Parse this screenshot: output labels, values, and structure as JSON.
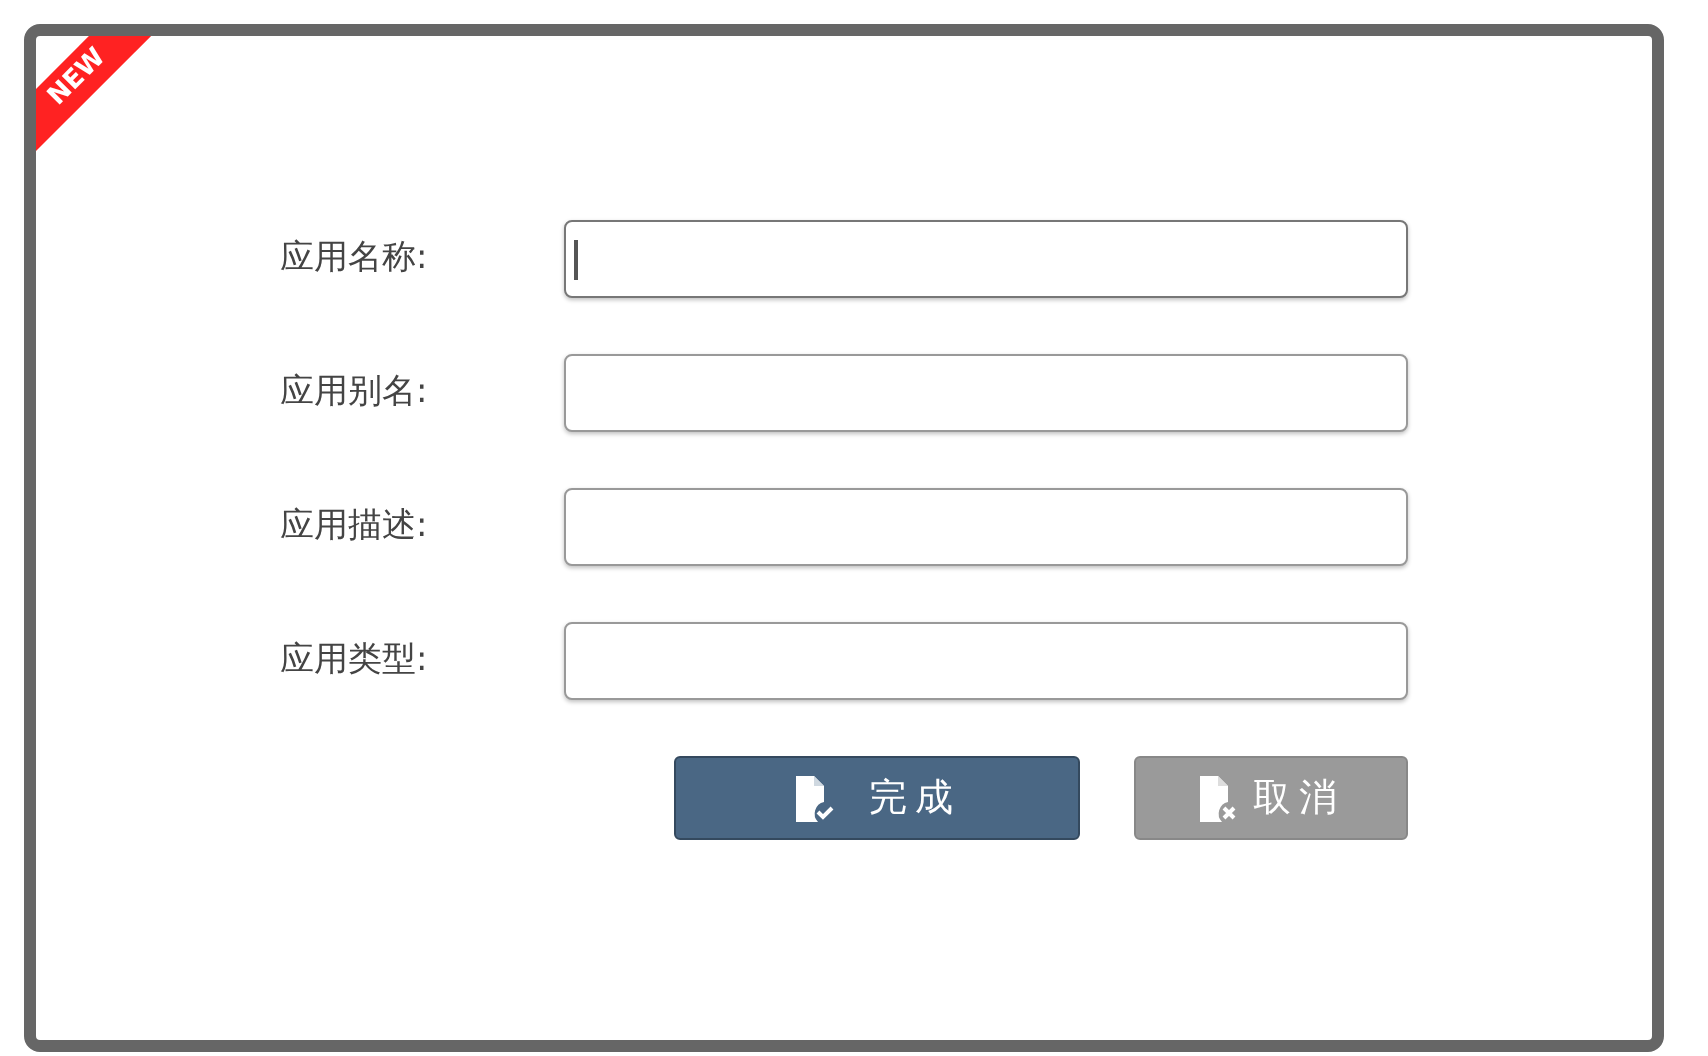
{
  "ribbon": {
    "label": "NEW"
  },
  "fields": [
    {
      "label": "应用名称:",
      "focused": true
    },
    {
      "label": "应用别名:",
      "focused": false
    },
    {
      "label": "应用描述:",
      "focused": false
    },
    {
      "label": "应用类型:",
      "focused": false
    }
  ],
  "buttons": [
    {
      "label": "完成",
      "kind": "confirm"
    },
    {
      "label": "取消",
      "kind": "cancel"
    }
  ]
}
